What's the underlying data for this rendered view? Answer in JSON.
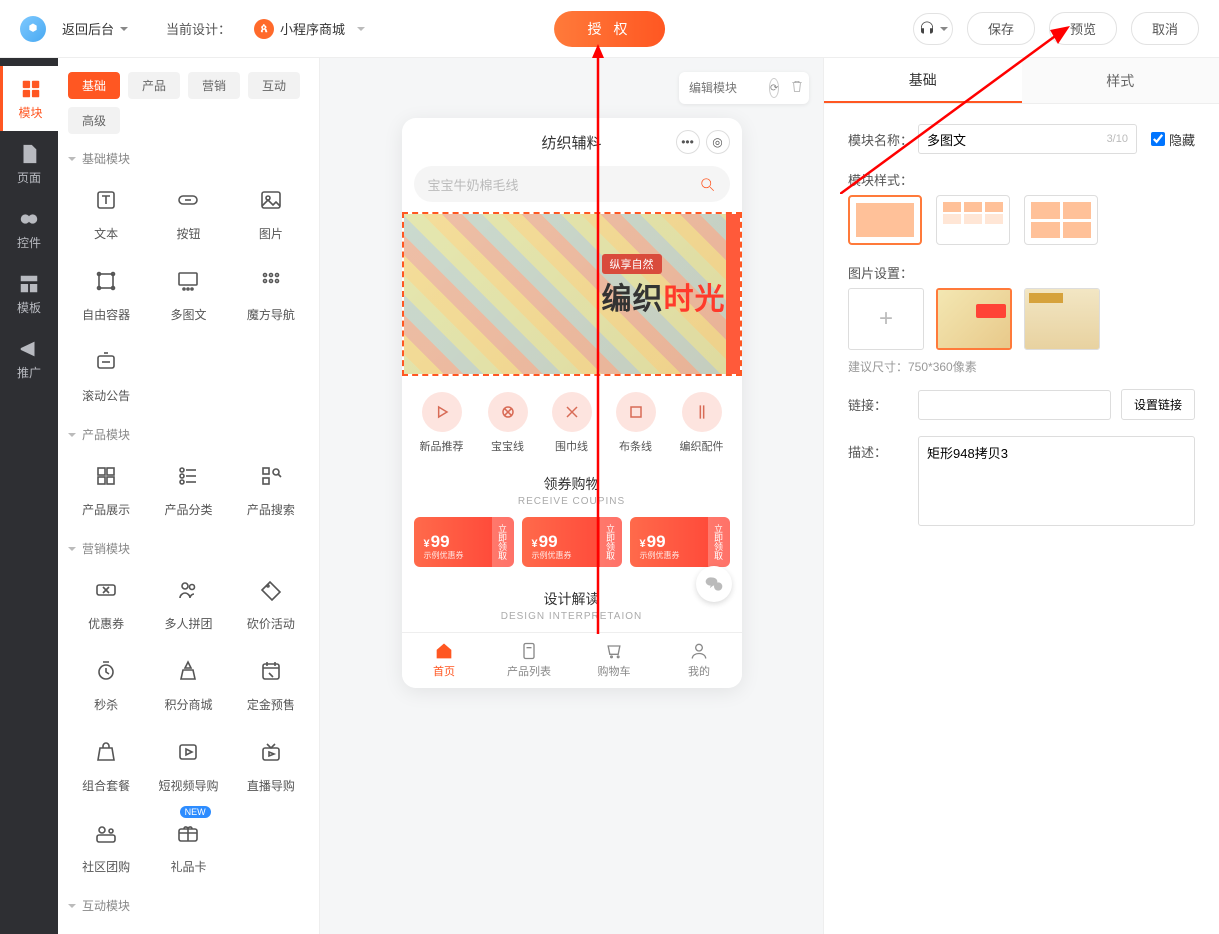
{
  "topbar": {
    "back": "返回后台",
    "design_label": "当前设计：",
    "design_name": "小程序商城",
    "auth": "授 权",
    "save": "保存",
    "preview": "预览",
    "cancel": "取消"
  },
  "rail": [
    {
      "key": "module",
      "label": "模块"
    },
    {
      "key": "page",
      "label": "页面"
    },
    {
      "key": "control",
      "label": "控件"
    },
    {
      "key": "template",
      "label": "模板"
    },
    {
      "key": "promote",
      "label": "推广"
    }
  ],
  "cat_tabs": [
    "基础",
    "产品",
    "营销",
    "互动",
    "高级"
  ],
  "sections": {
    "basic": {
      "title": "基础模块",
      "items": [
        "文本",
        "按钮",
        "图片",
        "自由容器",
        "多图文",
        "魔方导航",
        "滚动公告"
      ]
    },
    "product": {
      "title": "产品模块",
      "items": [
        "产品展示",
        "产品分类",
        "产品搜索"
      ]
    },
    "marketing": {
      "title": "营销模块",
      "items": [
        "优惠券",
        "多人拼团",
        "砍价活动",
        "秒杀",
        "积分商城",
        "定金预售",
        "组合套餐",
        "短视频导购",
        "直播导购",
        "社区团购",
        "礼品卡"
      ]
    },
    "interact": {
      "title": "互动模块"
    }
  },
  "badge_new": "NEW",
  "module_bar": {
    "placeholder": "编辑模块"
  },
  "phone": {
    "title": "纺织辅料",
    "search_ph": "宝宝牛奶棉毛线",
    "banner_tag": "纵享自然",
    "banner_big_a": "编织",
    "banner_big_b": "时光",
    "cats": [
      "新品推荐",
      "宝宝线",
      "围巾线",
      "布条线",
      "编织配件"
    ],
    "sec1_t": "领券购物",
    "sec1_s": "RECEIVE COUPINS",
    "coupon_price": "99",
    "coupon_sub": "示例优惠券",
    "coupon_act": "立即领取",
    "sec2_t": "设计解读",
    "sec2_s": "DESIGN INTERPRETAION",
    "tabs": [
      "首页",
      "产品列表",
      "购物车",
      "我的"
    ]
  },
  "right": {
    "tab_basic": "基础",
    "tab_style": "样式",
    "name_lbl": "模块名称：",
    "name_val": "多图文",
    "name_cnt": "3/10",
    "hide": "隐藏",
    "style_lbl": "模块样式：",
    "img_lbl": "图片设置：",
    "size_hint": "建议尺寸：750*360像素",
    "link_lbl": "链接：",
    "set_link": "设置链接",
    "desc_lbl": "描述：",
    "desc_val": "矩形948拷贝3"
  }
}
